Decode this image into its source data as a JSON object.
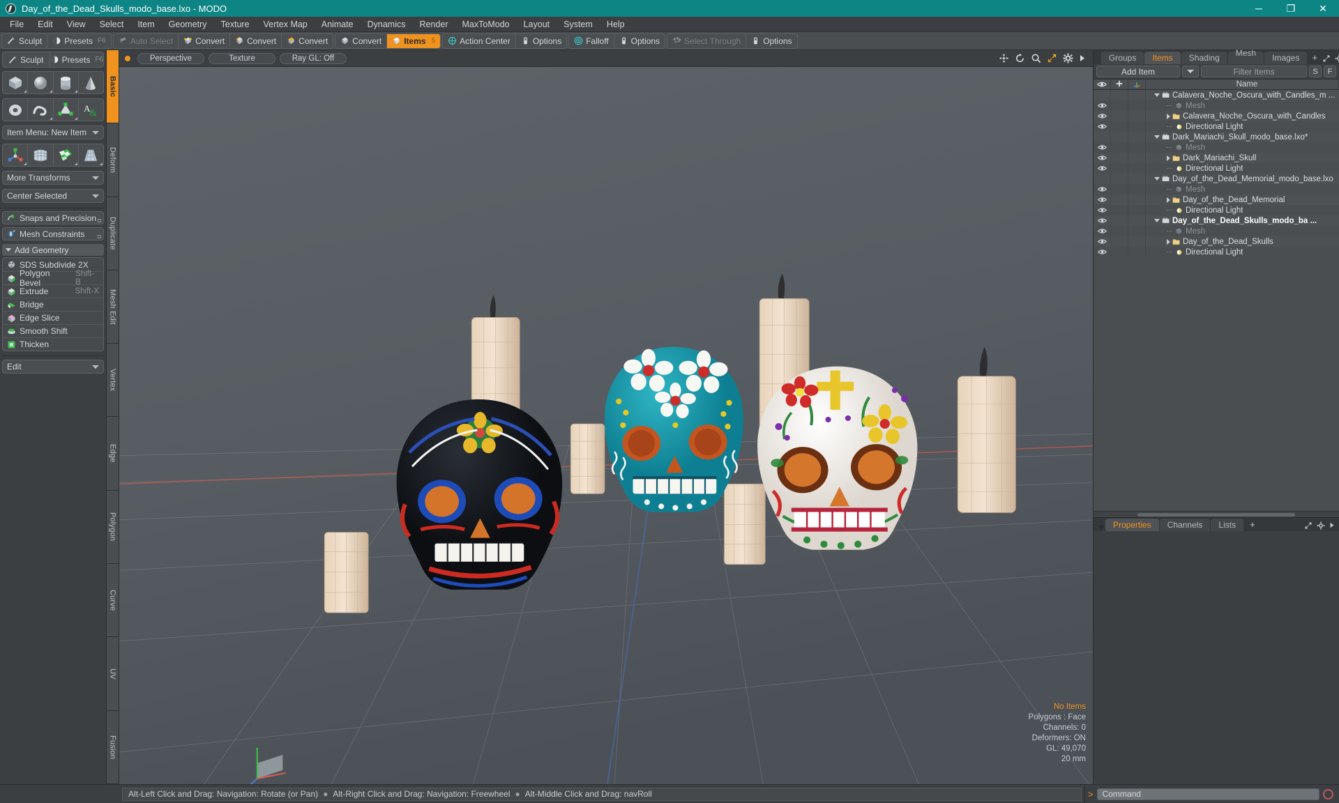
{
  "titlebar": {
    "title": "Day_of_the_Dead_Skulls_modo_base.lxo - MODO",
    "logo": "modo-logo-icon",
    "minimize": "─",
    "maximize": "❐",
    "close": "✕"
  },
  "menubar": {
    "items": [
      "File",
      "Edit",
      "View",
      "Select",
      "Item",
      "Geometry",
      "Texture",
      "Vertex Map",
      "Animate",
      "Dynamics",
      "Render",
      "MaxToModo",
      "Layout",
      "System",
      "Help"
    ]
  },
  "modebar": {
    "groups": [
      {
        "buttons": [
          {
            "label": "Sculpt",
            "icon": "sculpt-icon",
            "state": "normal"
          },
          {
            "label": "Presets",
            "icon": "presets-icon",
            "state": "normal",
            "shortcut": "F6"
          }
        ]
      },
      {
        "buttons": [
          {
            "label": "Auto Select",
            "icon": "auto-select-icon",
            "state": "disabled"
          },
          {
            "label": "Convert",
            "icon": "convert-vertex-icon",
            "state": "normal"
          },
          {
            "label": "Convert",
            "icon": "convert-edge-icon",
            "state": "normal"
          },
          {
            "label": "Convert",
            "icon": "convert-polygon-icon",
            "state": "normal"
          }
        ]
      },
      {
        "buttons": [
          {
            "label": "Convert",
            "icon": "convert-material-icon",
            "state": "normal"
          },
          {
            "label": "Items",
            "icon": "items-icon",
            "state": "active",
            "number": "5"
          }
        ]
      },
      {
        "buttons": [
          {
            "label": "Action Center",
            "icon": "action-center-icon",
            "state": "normal"
          },
          {
            "label": "Options",
            "icon": "options-icon",
            "state": "normal"
          }
        ]
      },
      {
        "buttons": [
          {
            "label": "Falloff",
            "icon": "falloff-icon",
            "state": "normal"
          },
          {
            "label": "Options",
            "icon": "options-icon",
            "state": "normal"
          }
        ]
      },
      {
        "buttons": [
          {
            "label": "Select Through",
            "icon": "select-through-icon",
            "state": "disabled"
          },
          {
            "label": "Options",
            "icon": "options-icon",
            "state": "normal"
          }
        ]
      }
    ]
  },
  "leftpanel": {
    "topbar": [
      {
        "label": "Sculpt",
        "icon": "brush-icon"
      },
      {
        "label": "Presets",
        "icon": "sphere-preset-icon",
        "shortcut": "F6"
      }
    ],
    "primitives_row1": [
      "cube-icon",
      "sphere-icon",
      "cylinder-icon",
      "cone-icon"
    ],
    "primitives_row2": [
      "torus-icon",
      "spiral-icon",
      "polygon-mesh-icon",
      "text-tool-icon"
    ],
    "item_menu": "Item Menu: New Item",
    "transform_icons": [
      "transform-gizmo-icon",
      "bend-lattice-icon",
      "checker-polygon-icon",
      "taper-icon"
    ],
    "more_transforms": "More Transforms",
    "center_selected": "Center Selected",
    "snaps": {
      "label": "Snaps and Precision",
      "icon": "snap-arrow-icon"
    },
    "constraints": {
      "label": "Mesh Constraints",
      "icon": "mesh-constraint-icon"
    },
    "add_geometry_header": "Add Geometry",
    "geometry_tools": [
      {
        "label": "SDS Subdivide 2X",
        "icon": "sds-subdivide-icon",
        "shortcut": ""
      },
      {
        "label": "Polygon Bevel",
        "icon": "polygon-bevel-icon",
        "shortcut": "Shift-B"
      },
      {
        "label": "Extrude",
        "icon": "extrude-icon",
        "shortcut": "Shift-X"
      },
      {
        "label": "Bridge",
        "icon": "bridge-icon",
        "shortcut": ""
      },
      {
        "label": "Edge Slice",
        "icon": "edge-slice-icon",
        "shortcut": ""
      },
      {
        "label": "Smooth Shift",
        "icon": "smooth-shift-icon",
        "shortcut": ""
      },
      {
        "label": "Thicken",
        "icon": "thicken-icon",
        "shortcut": ""
      }
    ],
    "edit_dropdown": "Edit"
  },
  "vtabs": {
    "items": [
      "Basic",
      "Deform",
      "Duplicate",
      "Mesh Edit",
      "Vertex",
      "Edge",
      "Polygon",
      "Curve",
      "UV",
      "Fusion"
    ],
    "active": "Basic"
  },
  "viewport": {
    "header": {
      "buttons": [
        "Perspective",
        "Texture",
        "Ray GL: Off"
      ],
      "icons": [
        "move-icon",
        "rotate-icon",
        "zoom-icon",
        "fit-icon",
        "gear-icon",
        "chevron-right-icon"
      ]
    },
    "stats": {
      "selection": "No Items",
      "polygons": "Polygons : Face",
      "channels": "Channels: 0",
      "deformers": "Deformers: ON",
      "gl": "GL: 49,070",
      "grid": "20 mm"
    },
    "axis_widget": "axis-gizmo-icon"
  },
  "rightpanel": {
    "tabs": [
      {
        "label": "Groups",
        "active": false
      },
      {
        "label": "Items",
        "active": true
      },
      {
        "label": "Shading",
        "active": false
      },
      {
        "label": "Mesh ...",
        "active": false
      },
      {
        "label": "Images",
        "active": false
      }
    ],
    "tab_plus": "+",
    "tab_icons": [
      "expand-icon",
      "gear-icon",
      "chevron-right-icon"
    ],
    "add_item": "Add Item",
    "filter_placeholder": "Filter Items",
    "s_button": "S",
    "f_button": "F",
    "columns": {
      "eye": "eye-icon",
      "plus": "plus-icon",
      "axis": "axis-icon",
      "name": "Name"
    },
    "tree": [
      {
        "type": "scene",
        "label": "Calavera_Noche_Oscura_with_Candles_m ...",
        "icon": "scene-icon",
        "expander": "down",
        "eye": false,
        "bold": false
      },
      {
        "type": "child",
        "label": "Mesh",
        "icon": "mesh-icon",
        "expander": "stub",
        "eye": true,
        "dim": true
      },
      {
        "type": "child",
        "label": "Calavera_Noche_Oscura_with_Candles",
        "icon": "folder-icon",
        "expander": "right",
        "eye": true,
        "dim": false
      },
      {
        "type": "child",
        "label": "Directional Light",
        "icon": "light-icon",
        "expander": "stub",
        "eye": true,
        "dim": false
      },
      {
        "type": "scene",
        "label": "Dark_Mariachi_Skull_modo_base.lxo*",
        "icon": "scene-icon",
        "expander": "down",
        "eye": false,
        "bold": false
      },
      {
        "type": "child",
        "label": "Mesh",
        "icon": "mesh-icon",
        "expander": "stub",
        "eye": true,
        "dim": true
      },
      {
        "type": "child",
        "label": "Dark_Mariachi_Skull",
        "icon": "folder-icon",
        "expander": "right",
        "eye": true,
        "dim": false
      },
      {
        "type": "child",
        "label": "Directional Light",
        "icon": "light-icon",
        "expander": "stub",
        "eye": true,
        "dim": false
      },
      {
        "type": "scene",
        "label": "Day_of_the_Dead_Memorial_modo_base.lxo",
        "icon": "scene-icon",
        "expander": "down",
        "eye": false,
        "bold": false
      },
      {
        "type": "child",
        "label": "Mesh",
        "icon": "mesh-icon",
        "expander": "stub",
        "eye": true,
        "dim": true
      },
      {
        "type": "child",
        "label": "Day_of_the_Dead_Memorial",
        "icon": "folder-icon",
        "expander": "right",
        "eye": true,
        "dim": false
      },
      {
        "type": "child",
        "label": "Directional Light",
        "icon": "light-icon",
        "expander": "stub",
        "eye": true,
        "dim": false
      },
      {
        "type": "scene",
        "label": "Day_of_the_Dead_Skulls_modo_ba ...",
        "icon": "scene-icon",
        "expander": "down",
        "eye": true,
        "bold": true
      },
      {
        "type": "child",
        "label": "Mesh",
        "icon": "mesh-icon",
        "expander": "stub",
        "eye": true,
        "dim": true
      },
      {
        "type": "child",
        "label": "Day_of_the_Dead_Skulls",
        "icon": "folder-icon",
        "expander": "right",
        "eye": true,
        "dim": false
      },
      {
        "type": "child",
        "label": "Directional Light",
        "icon": "light-icon",
        "expander": "stub",
        "eye": true,
        "dim": false
      }
    ],
    "bottom_tabs": [
      {
        "label": "Properties",
        "active": true
      },
      {
        "label": "Channels",
        "active": false
      },
      {
        "label": "Lists",
        "active": false
      }
    ],
    "bottom_tab_plus": "+",
    "bottom_tab_icons": [
      "expand-icon",
      "gear-icon",
      "chevron-right-icon"
    ]
  },
  "statusbar": {
    "hints": [
      "Alt-Left Click and Drag: Navigation: Rotate (or Pan)",
      "Alt-Right Click and Drag: Navigation: Freewheel",
      "Alt-Middle Click and Drag: navRoll"
    ],
    "separator": "●",
    "command_prompt": ">",
    "command_placeholder": "Command",
    "record_button": "record-icon"
  },
  "colors": {
    "title_bar": "#0d8585",
    "accent": "#f0921e",
    "panel": "#3c3f41",
    "viewport_bg": "#555b60",
    "x_axis": "#c45b4a",
    "z_axis": "#4a6fc4"
  }
}
